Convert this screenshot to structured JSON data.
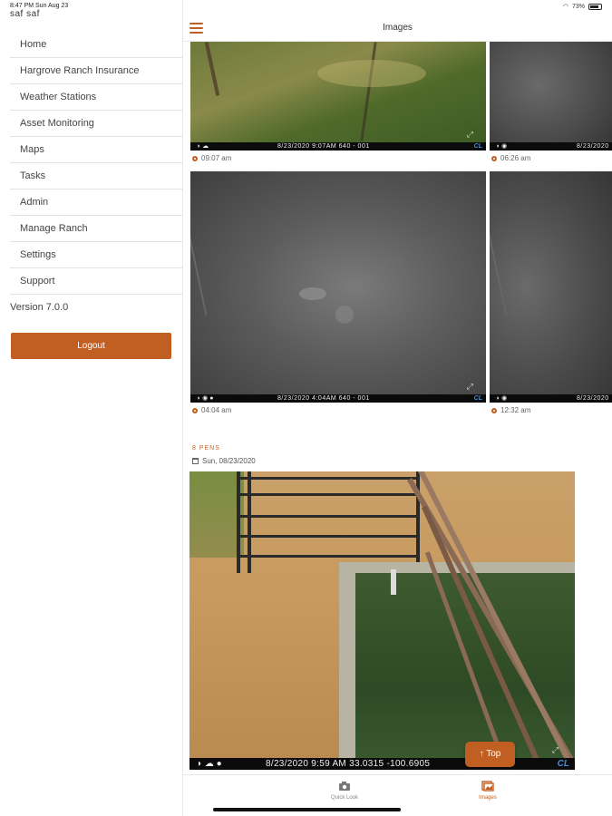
{
  "status": {
    "time": "8:47 PM  Sun Aug 23",
    "battery": "73%"
  },
  "user": {
    "name": "saf saf"
  },
  "sidebar": {
    "items": [
      {
        "label": "Home"
      },
      {
        "label": "Hargrove Ranch Insurance"
      },
      {
        "label": "Weather Stations"
      },
      {
        "label": "Asset Monitoring"
      },
      {
        "label": "Maps"
      },
      {
        "label": "Tasks"
      },
      {
        "label": "Admin"
      },
      {
        "label": "Manage Ranch"
      },
      {
        "label": "Settings"
      },
      {
        "label": "Support"
      }
    ],
    "version": "Version 7.0.0",
    "logout_label": "Logout"
  },
  "header": {
    "title": "Images"
  },
  "images": [
    {
      "stamp": "8/23/2020   9:07AM   640 - 001",
      "time": "09:07 am"
    },
    {
      "stamp": "8/23/2020",
      "time": "06:26 am"
    },
    {
      "stamp": "8/23/2020   4:04AM   640 - 001",
      "time": "04:04 am"
    },
    {
      "stamp": "8/23/2020",
      "time": "12:32 am"
    }
  ],
  "section": {
    "camera": "8 PENS",
    "date": "Sun, 08/23/2020",
    "big_stamp": "8/23/2020   9:59 AM   33.0315 -100.6905"
  },
  "top_button": {
    "label": "↑ Top"
  },
  "tabs": [
    {
      "label": "Quick Look",
      "icon": "camera-icon"
    },
    {
      "label": "Images",
      "icon": "images-icon"
    }
  ],
  "colors": {
    "accent": "#c15f22"
  }
}
